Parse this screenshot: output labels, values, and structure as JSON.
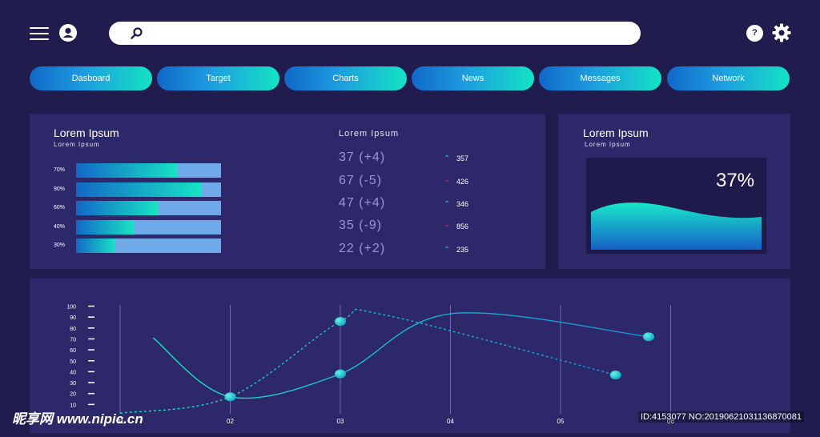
{
  "header": {
    "menu_icon": "hamburger-menu-icon",
    "user_icon": "user-icon",
    "search": {
      "icon": "search-icon",
      "value": "",
      "placeholder": ""
    },
    "help_icon": "help-icon",
    "help_label": "?",
    "settings_icon": "gear-icon"
  },
  "nav": {
    "tabs": [
      {
        "label": "Dasboard"
      },
      {
        "label": "Target"
      },
      {
        "label": "Charts"
      },
      {
        "label": "News"
      },
      {
        "label": "Messages"
      },
      {
        "label": "Network"
      }
    ]
  },
  "progress_panel": {
    "title": "Lorem Ipsum",
    "subtitle": "Lorem Ipsum",
    "bars": [
      {
        "label": "70%",
        "value": 0.7
      },
      {
        "label": "90%",
        "value": 0.86
      },
      {
        "label": "60%",
        "value": 0.57
      },
      {
        "label": "40%",
        "value": 0.4
      },
      {
        "label": "30%",
        "value": 0.27
      }
    ]
  },
  "stats_panel": {
    "title": "Lorem Ipsum",
    "rows": [
      {
        "value": "37 (+4)",
        "direction": "up",
        "count": "357"
      },
      {
        "value": "67 (-5)",
        "direction": "down",
        "count": "426"
      },
      {
        "value": "47 (+4)",
        "direction": "up",
        "count": "346"
      },
      {
        "value": "35 (-9)",
        "direction": "down",
        "count": "856"
      },
      {
        "value": "22 (+2)",
        "direction": "up",
        "count": "235"
      }
    ],
    "up_symbol": "⌃",
    "down_symbol": "⌄"
  },
  "gauge_panel": {
    "title": "Lorem Ipsum",
    "subtitle": "Lorem Ipsum",
    "percent_label": "37%"
  },
  "colors": {
    "background": "#211c4e",
    "panel": "#2d2869",
    "accent_teal": "#18e3c4",
    "accent_blue": "#1068c8",
    "up": "#19d0c0",
    "down": "#e0305a"
  },
  "chart_data": {
    "type": "line",
    "y_ticks": [
      "100",
      "90",
      "80",
      "70",
      "60",
      "50",
      "40",
      "30",
      "20",
      "10"
    ],
    "x_ticks": [
      "01",
      "02",
      "03",
      "04",
      "05",
      "06"
    ],
    "ylim": [
      0,
      100
    ],
    "grid": "vertical",
    "series": [
      {
        "style": "solid",
        "x": [
          0.3,
          1,
          2,
          3,
          4.8
        ],
        "y": [
          71,
          17,
          38,
          93,
          72
        ],
        "markers": [
          [
            1,
            17
          ],
          [
            2,
            38
          ],
          [
            4.8,
            72
          ]
        ]
      },
      {
        "style": "dashed",
        "x": [
          0,
          1,
          2,
          2.4,
          4.5
        ],
        "y": [
          2,
          17,
          86,
          92,
          37
        ],
        "markers": [
          [
            2,
            86
          ],
          [
            4.5,
            37
          ]
        ]
      }
    ]
  },
  "watermark": {
    "site": "昵享网 www.nipic.cn",
    "id_text": "ID:4153077 NO:20190621031136870081"
  }
}
